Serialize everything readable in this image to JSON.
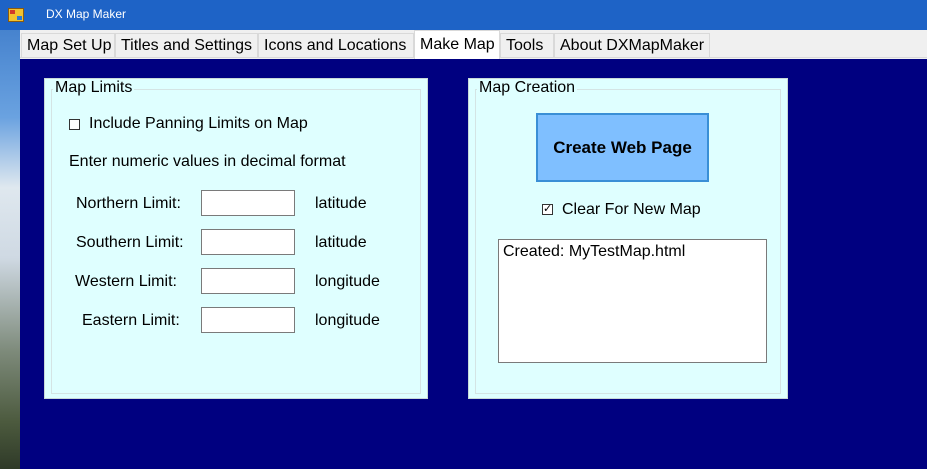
{
  "window": {
    "title": "DX Map Maker"
  },
  "tabs": [
    {
      "label": "Map Set Up"
    },
    {
      "label": "Titles and Settings"
    },
    {
      "label": "Icons and Locations"
    },
    {
      "label": "Make Map"
    },
    {
      "label": "Tools"
    },
    {
      "label": "About DXMapMaker"
    }
  ],
  "active_tab": "Make Map",
  "map_limits": {
    "title": "Map Limits",
    "include_panning_label": "Include Panning Limits on Map",
    "include_panning_checked": false,
    "instruction": "Enter numeric values in decimal format",
    "fields": [
      {
        "label": "Northern Limit:",
        "value": "",
        "unit": "latitude"
      },
      {
        "label": "Southern Limit:",
        "value": "",
        "unit": "latitude"
      },
      {
        "label": "Western Limit:",
        "value": "",
        "unit": "longitude"
      },
      {
        "label": "Eastern Limit:",
        "value": "",
        "unit": "longitude"
      }
    ]
  },
  "map_creation": {
    "title": "Map Creation",
    "create_button": "Create Web Page",
    "clear_label": "Clear For New Map",
    "clear_checked": true,
    "output_text": "Created: MyTestMap.html"
  },
  "colors": {
    "background": "#000080",
    "panel": "#dfffff",
    "button": "#7fbfff",
    "titlebar": "#1e63c6"
  }
}
